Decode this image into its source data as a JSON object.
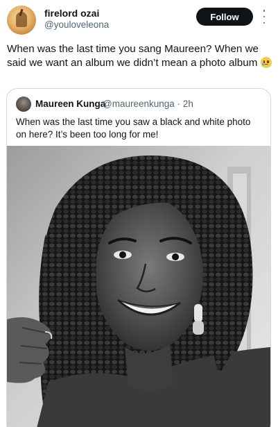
{
  "author": {
    "display_name": "firelord ozai",
    "handle": "@youloveleona",
    "avatar_icon": "profile-avatar-icon"
  },
  "actions": {
    "follow_label": "Follow",
    "more_icon": "more-vertical-icon"
  },
  "tweet": {
    "text": "When was the last time you sang Maureen? When we said we want an album we didn’t mean a photo album",
    "emoji": "pleading-face-emoji"
  },
  "quoted_tweet": {
    "author_name": "Maureen Kunga",
    "author_handle": "@maureenkunga",
    "separator": "·",
    "time": "2h",
    "text": "When was the last time you saw a black and white photo on here? It’s been too long for me!",
    "photo_icon": "black-and-white-portrait-photo"
  },
  "colors": {
    "text_primary": "#0f1419",
    "text_secondary": "#536471",
    "border": "#cfd9de",
    "follow_bg": "#0f1419"
  }
}
